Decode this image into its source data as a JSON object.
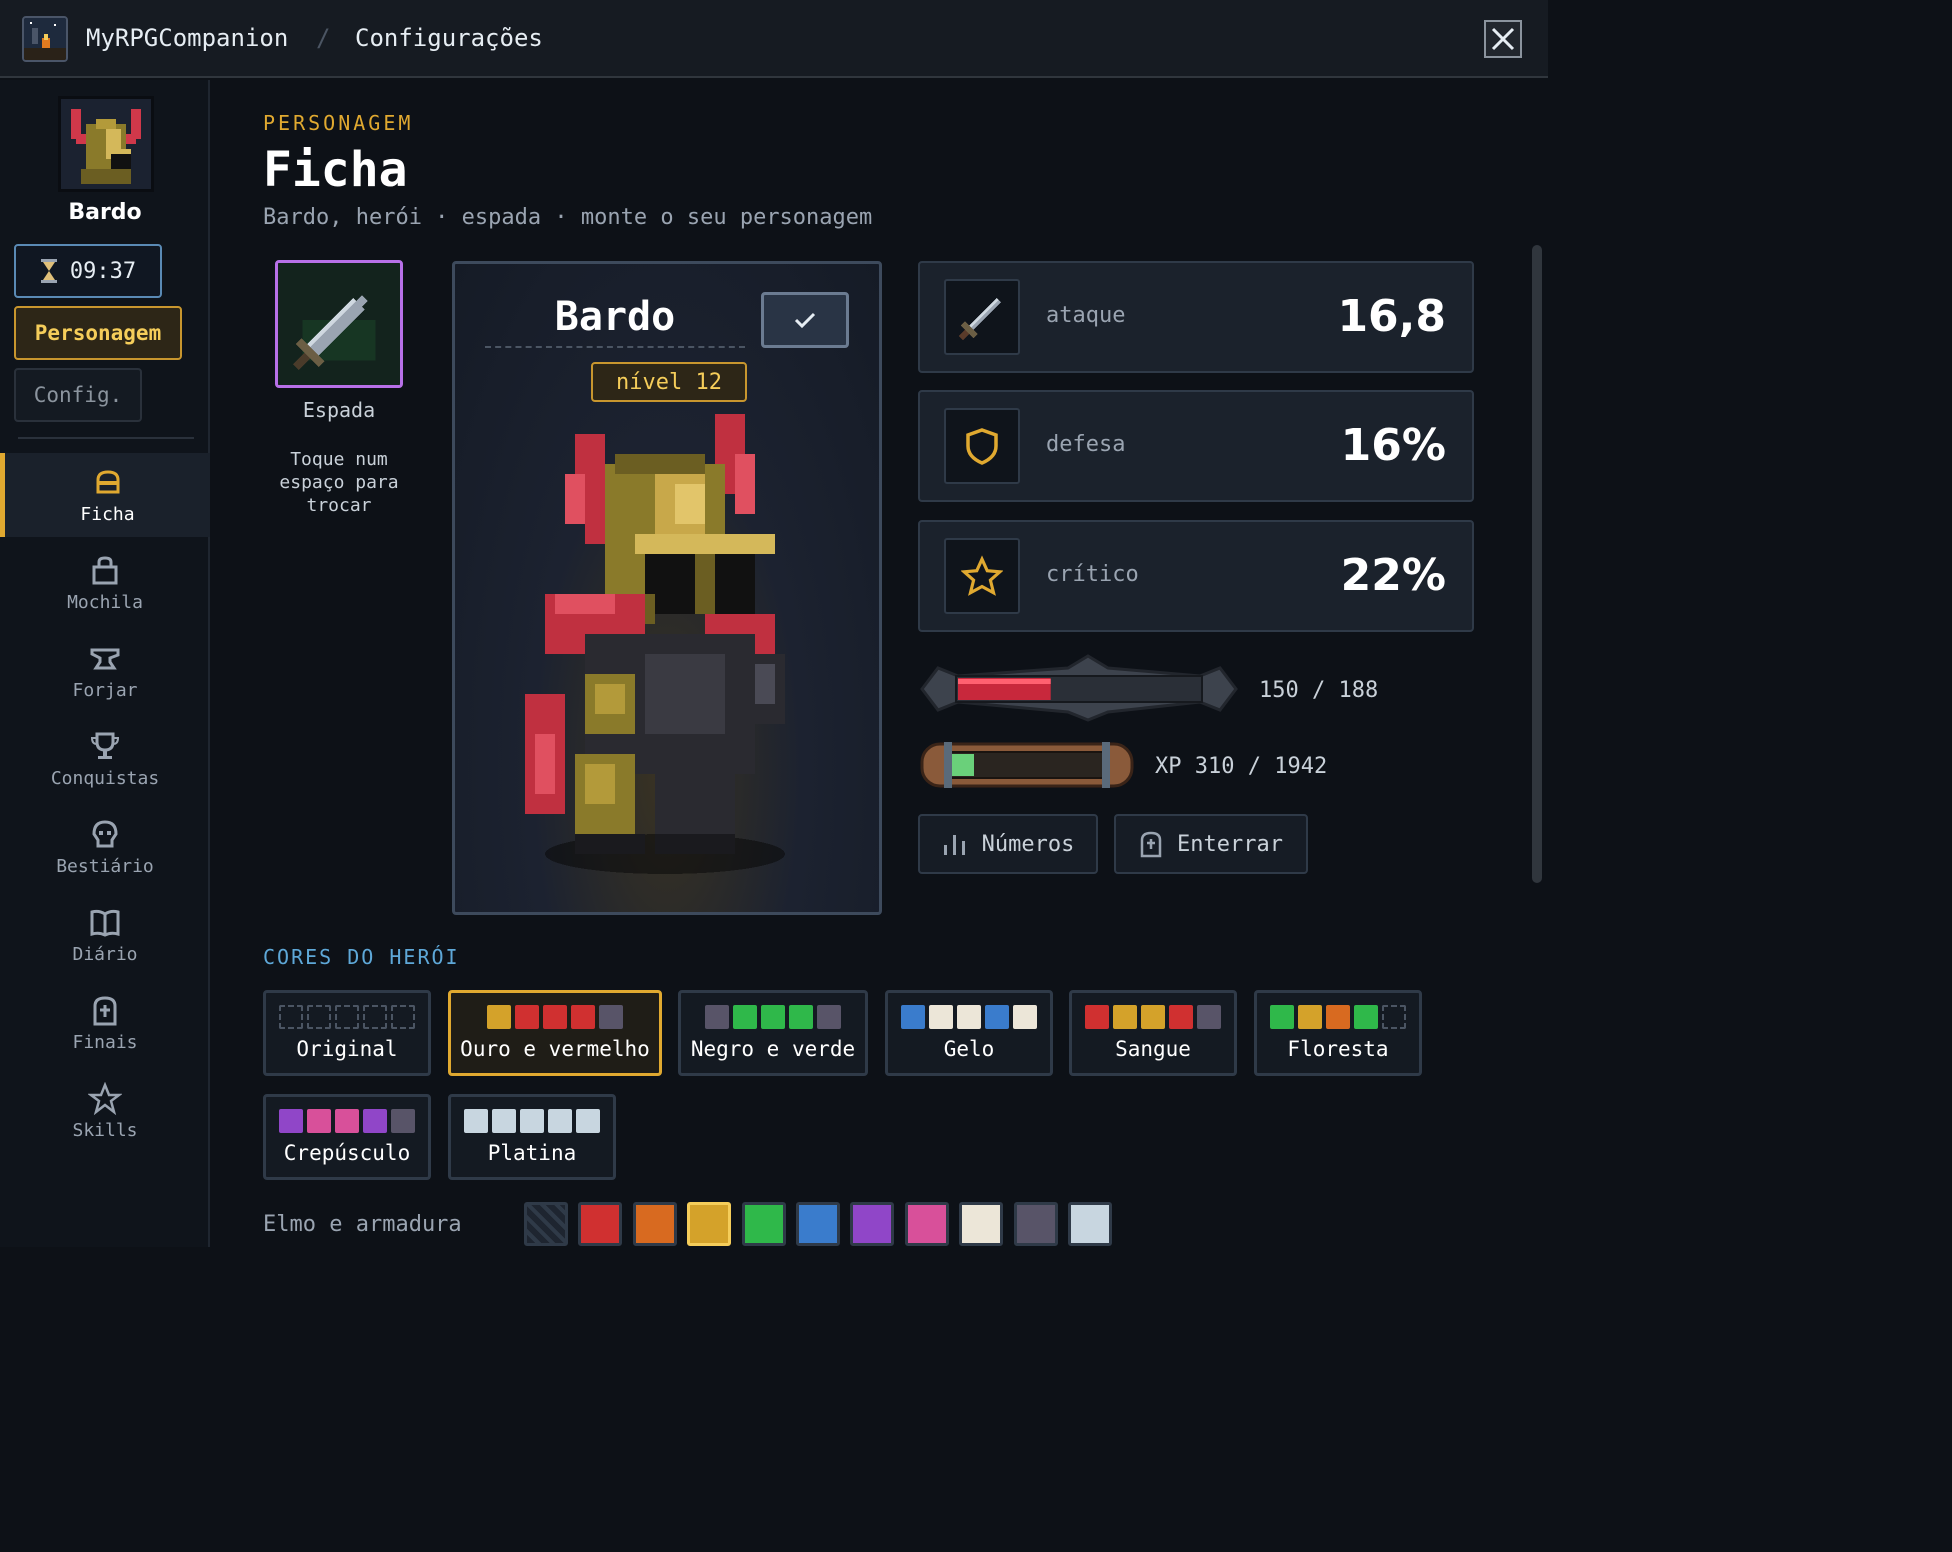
{
  "header": {
    "app_name": "MyRPGCompanion",
    "separator": "/",
    "page": "Configurações"
  },
  "sidebar": {
    "character_name": "Bardo",
    "timer": "09:37",
    "tab_personagem": "Personagem",
    "tab_config": "Config.",
    "items": [
      {
        "label": "Ficha",
        "icon": "helmet-icon",
        "active": true
      },
      {
        "label": "Mochila",
        "icon": "bag-icon",
        "active": false
      },
      {
        "label": "Forjar",
        "icon": "anvil-icon",
        "active": false
      },
      {
        "label": "Conquistas",
        "icon": "trophy-icon",
        "active": false
      },
      {
        "label": "Bestiário",
        "icon": "skull-icon",
        "active": false
      },
      {
        "label": "Diário",
        "icon": "book-icon",
        "active": false
      },
      {
        "label": "Finais",
        "icon": "tombstone-icon",
        "active": false
      },
      {
        "label": "Skills",
        "icon": "star-icon",
        "active": false
      }
    ]
  },
  "main": {
    "eyebrow": "PERSONAGEM",
    "title": "Ficha",
    "subtitle": "Bardo, herói · espada · monte o seu personagem",
    "weapon": {
      "label": "Espada",
      "hint": "Toque num espaço para trocar"
    },
    "character": {
      "name": "Bardo",
      "level": "nível 12"
    },
    "stats": [
      {
        "label": "ataque",
        "value": "16,8",
        "icon": "sword-icon"
      },
      {
        "label": "defesa",
        "value": "16%",
        "icon": "shield-icon"
      },
      {
        "label": "crítico",
        "value": "22%",
        "icon": "star-icon"
      }
    ],
    "hp": {
      "current": 150,
      "max": 188,
      "text": "150 / 188"
    },
    "xp": {
      "current": 310,
      "max": 1942,
      "text": "XP 310 / 1942"
    },
    "buttons": {
      "numbers": "Números",
      "bury": "Enterrar"
    },
    "colors_section": "CORES DO HERÓI",
    "palettes": [
      {
        "label": "Original",
        "colors": [
          "",
          "",
          "",
          "",
          ""
        ],
        "selected": false
      },
      {
        "label": "Ouro e vermelho",
        "colors": [
          "#d4a22a",
          "#d03030",
          "#d03030",
          "#d03030",
          "#585468"
        ],
        "selected": true
      },
      {
        "label": "Negro e verde",
        "colors": [
          "#585468",
          "#2fb84a",
          "#2fb84a",
          "#2fb84a",
          "#585468"
        ],
        "selected": false
      },
      {
        "label": "Gelo",
        "colors": [
          "#3a7ccc",
          "#ece6d8",
          "#ece6d8",
          "#3a7ccc",
          "#ece6d8"
        ],
        "selected": false
      },
      {
        "label": "Sangue",
        "colors": [
          "#d03030",
          "#d4a22a",
          "#d4a22a",
          "#d03030",
          "#585468"
        ],
        "selected": false
      },
      {
        "label": "Floresta",
        "colors": [
          "#2fb84a",
          "#d4a22a",
          "#d86a20",
          "#2fb84a",
          ""
        ],
        "selected": false
      },
      {
        "label": "Crepúsculo",
        "colors": [
          "#9046c8",
          "#d8509a",
          "#d8509a",
          "#9046c8",
          "#585468"
        ],
        "selected": false
      },
      {
        "label": "Platina",
        "colors": [
          "#c8d6e0",
          "#c8d6e0",
          "#c8d6e0",
          "#c8d6e0",
          "#c8d6e0"
        ],
        "selected": false
      }
    ],
    "armor_label": "Elmo e armadura",
    "armor_colors": [
      "none",
      "#d03030",
      "#d86a20",
      "#d4a22a",
      "#2fb84a",
      "#3a7ccc",
      "#9046c8",
      "#d8509a",
      "#ece6d8",
      "#585468",
      "#c8d6e0"
    ],
    "armor_selected_index": 3
  }
}
